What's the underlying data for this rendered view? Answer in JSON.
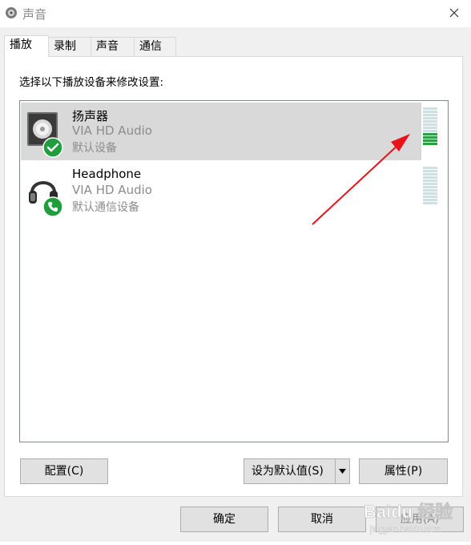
{
  "window": {
    "title": "声音",
    "close_icon": "close-icon",
    "app_icon": "speaker-knob-icon"
  },
  "tabs": [
    {
      "label": "播放",
      "active": true
    },
    {
      "label": "录制",
      "active": false
    },
    {
      "label": "声音",
      "active": false
    },
    {
      "label": "通信",
      "active": false
    }
  ],
  "playback": {
    "instruction": "选择以下播放设备来修改设置:",
    "devices": [
      {
        "name": "扬声器",
        "driver": "VIA HD Audio",
        "status": "默认设备",
        "icon": "speaker-icon",
        "badge": "checkmark-icon",
        "selected": true,
        "level": 0.35
      },
      {
        "name": "Headphone",
        "driver": "VIA HD Audio",
        "status": "默认通信设备",
        "icon": "headphone-icon",
        "badge": "phone-icon",
        "selected": false,
        "level": 0
      }
    ],
    "buttons": {
      "configure": "配置(C)",
      "set_default": "设为默认值(S)",
      "properties": "属性(P)"
    }
  },
  "footer": {
    "ok": "确定",
    "cancel": "取消",
    "apply": "应用(A)"
  },
  "watermark": {
    "text": "Baidu 经验",
    "sub": "jingyan.baidu.com"
  },
  "colors": {
    "meter_active": "#2ea043",
    "meter_idle": "#cfe0e3",
    "selection": "#d9d9d9",
    "annotation_arrow": "#e8131b",
    "badge_green": "#1e9e3c"
  }
}
